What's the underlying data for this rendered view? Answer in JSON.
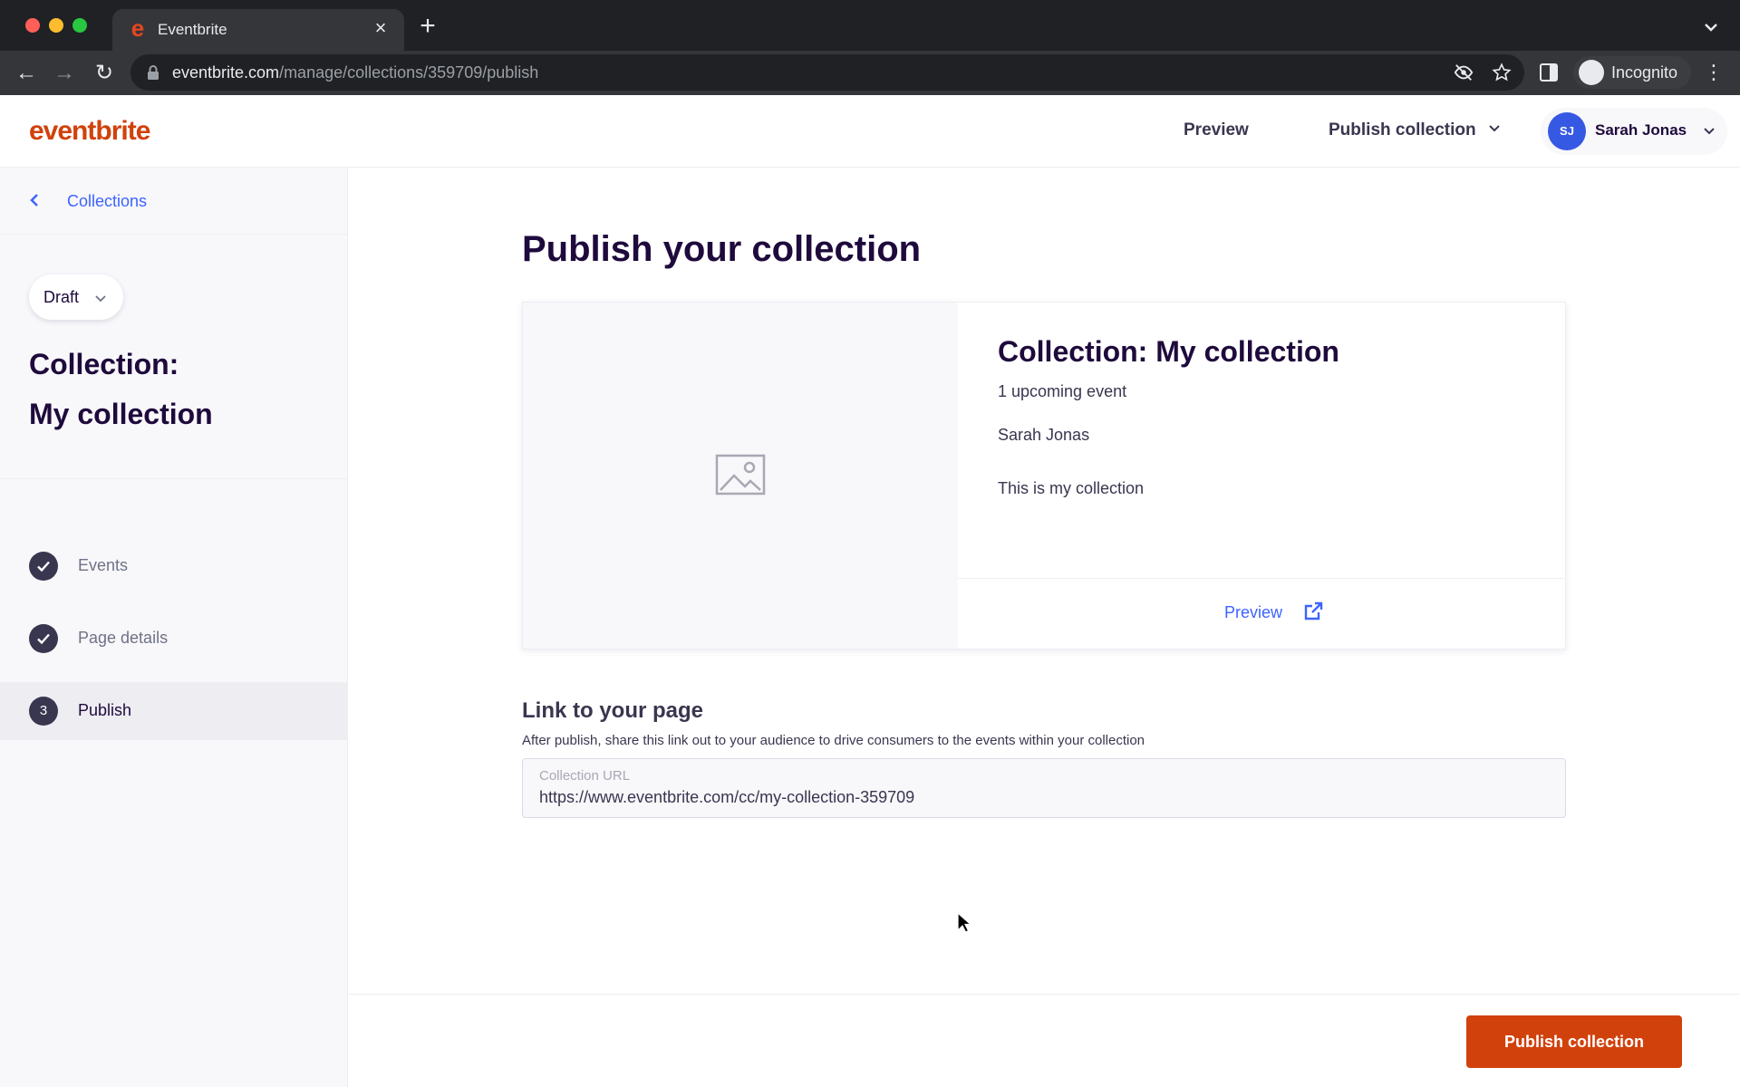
{
  "browser": {
    "tab_title": "Eventbrite",
    "tab_favicon": "e",
    "tab_close": "×",
    "new_tab": "+",
    "url_host": "eventbrite.com",
    "url_path": "/manage/collections/359709/publish",
    "profile_label": "Incognito",
    "menu_glyph": "⋮",
    "back_glyph": "←",
    "forward_glyph": "→",
    "reload_glyph": "↻"
  },
  "header": {
    "logo": "eventbrite",
    "preview": "Preview",
    "publish_menu": "Publish collection",
    "user_initials": "SJ",
    "user_name": "Sarah Jonas",
    "brand_color": "#d1410c",
    "avatar_color": "#3659e3"
  },
  "sidebar": {
    "back_label": "Collections",
    "status": "Draft",
    "title_line1": "Collection:",
    "title_line2": "My collection",
    "steps": [
      {
        "label": "Events",
        "state": "complete"
      },
      {
        "label": "Page details",
        "state": "complete"
      },
      {
        "label": "Publish",
        "number": "3",
        "state": "current"
      }
    ]
  },
  "main": {
    "page_title": "Publish your collection",
    "card": {
      "title": "Collection: My collection",
      "meta": "1 upcoming event",
      "organizer": "Sarah Jonas",
      "description": "This is my collection",
      "preview_link": "Preview"
    },
    "link_section": {
      "title": "Link to your page",
      "help": "After publish, share this link out to your audience to drive consumers to the events within your collection",
      "field_label": "Collection URL",
      "field_value": "https://www.eventbrite.com/cc/my-collection-359709"
    },
    "publish_button": "Publish collection"
  }
}
